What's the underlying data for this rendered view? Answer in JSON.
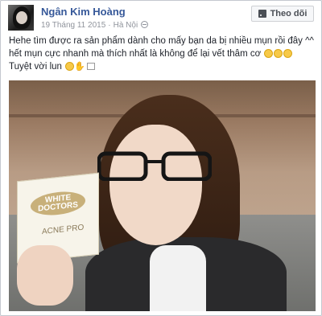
{
  "author": {
    "name": "Ngân Kim Hoàng"
  },
  "meta": {
    "date": "19 Tháng 11 2015",
    "location": "Hà Nội"
  },
  "follow_button": {
    "label": "Theo dõi"
  },
  "post": {
    "line1": "Hehe tìm được ra sản phẩm dành cho mấy bạn da bị nhiều mụn rồi đây ^^",
    "line2": "hết mụn cực nhanh mà thích nhất là không để lại vết thâm cơ",
    "line3": "Tuyệt vời lun"
  },
  "product": {
    "brand": "WHITE DOCTORS",
    "name": "ACNE PRO"
  },
  "icons": [
    "rss-icon",
    "globe-icon",
    "smiley-emoji-icon",
    "hand-emoji-icon"
  ],
  "colors": {
    "link": "#365899",
    "meta": "#90949c",
    "text": "#1d2129"
  }
}
